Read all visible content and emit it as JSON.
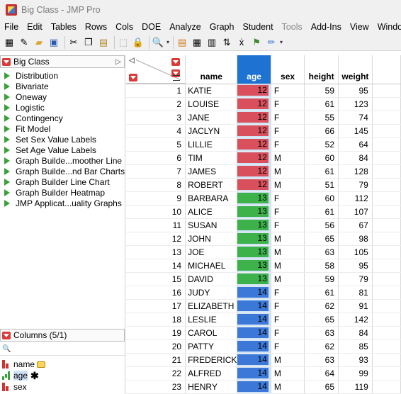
{
  "window": {
    "title": "Big Class - JMP Pro"
  },
  "menu": [
    "File",
    "Edit",
    "Tables",
    "Rows",
    "Cols",
    "DOE",
    "Analyze",
    "Graph",
    "Student",
    "Tools",
    "Add-Ins",
    "View",
    "Window"
  ],
  "menu_disabled": [
    "Tools"
  ],
  "table_panel": {
    "title": "Big Class",
    "scripts": [
      "Distribution",
      "Bivariate",
      "Oneway",
      "Logistic",
      "Contingency",
      "Fit Model",
      "Set Sex Value Labels",
      "Set Age Value Labels",
      "Graph Builde...moother Line",
      "Graph Builde...nd Bar Charts",
      "Graph Builder Line Chart",
      "Graph Builder Heatmap",
      "JMP Applicat...uality Graphs"
    ]
  },
  "columns_panel": {
    "title": "Columns (5/1)",
    "search_icon": "🔍",
    "columns": [
      {
        "name": "name",
        "type": "nominal",
        "label": true
      },
      {
        "name": "age",
        "type": "ordinal",
        "selected": true,
        "starred": true
      },
      {
        "name": "sex",
        "type": "nominal"
      }
    ]
  },
  "grid": {
    "headers": [
      "name",
      "age",
      "sex",
      "height",
      "weight"
    ],
    "age_colors": {
      "12": "#d9505c",
      "13": "#3db24b",
      "14": "#3b78d8"
    },
    "rows": [
      [
        1,
        "KATIE",
        12,
        "F",
        59,
        95
      ],
      [
        2,
        "LOUISE",
        12,
        "F",
        61,
        123
      ],
      [
        3,
        "JANE",
        12,
        "F",
        55,
        74
      ],
      [
        4,
        "JACLYN",
        12,
        "F",
        66,
        145
      ],
      [
        5,
        "LILLIE",
        12,
        "F",
        52,
        64
      ],
      [
        6,
        "TIM",
        12,
        "M",
        60,
        84
      ],
      [
        7,
        "JAMES",
        12,
        "M",
        61,
        128
      ],
      [
        8,
        "ROBERT",
        12,
        "M",
        51,
        79
      ],
      [
        9,
        "BARBARA",
        13,
        "F",
        60,
        112
      ],
      [
        10,
        "ALICE",
        13,
        "F",
        61,
        107
      ],
      [
        11,
        "SUSAN",
        13,
        "F",
        56,
        67
      ],
      [
        12,
        "JOHN",
        13,
        "M",
        65,
        98
      ],
      [
        13,
        "JOE",
        13,
        "M",
        63,
        105
      ],
      [
        14,
        "MICHAEL",
        13,
        "M",
        58,
        95
      ],
      [
        15,
        "DAVID",
        13,
        "M",
        59,
        79
      ],
      [
        16,
        "JUDY",
        14,
        "F",
        61,
        81
      ],
      [
        17,
        "ELIZABETH",
        14,
        "F",
        62,
        91
      ],
      [
        18,
        "LESLIE",
        14,
        "F",
        65,
        142
      ],
      [
        19,
        "CAROL",
        14,
        "F",
        63,
        84
      ],
      [
        20,
        "PATTY",
        14,
        "F",
        62,
        85
      ],
      [
        21,
        "FREDERICK",
        14,
        "M",
        63,
        93
      ],
      [
        22,
        "ALFRED",
        14,
        "M",
        64,
        99
      ],
      [
        23,
        "HENRY",
        14,
        "M",
        65,
        119
      ]
    ]
  }
}
